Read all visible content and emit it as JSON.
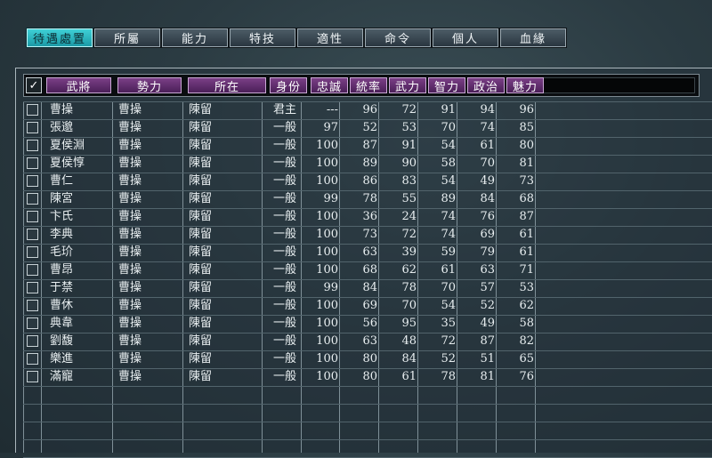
{
  "tabs": [
    {
      "label": "待遇處置",
      "active": true
    },
    {
      "label": "所屬",
      "active": false
    },
    {
      "label": "能力",
      "active": false
    },
    {
      "label": "特技",
      "active": false
    },
    {
      "label": "適性",
      "active": false
    },
    {
      "label": "命令",
      "active": false
    },
    {
      "label": "個人",
      "active": false
    },
    {
      "label": "血緣",
      "active": false
    }
  ],
  "table": {
    "check_all": "✓",
    "columns": [
      "武將",
      "勢力",
      "所在",
      "身份",
      "忠誠",
      "統率",
      "武力",
      "智力",
      "政治",
      "魅力"
    ],
    "rows": [
      [
        "曹操",
        "曹操",
        "陳留",
        "君主",
        "---",
        "96",
        "72",
        "91",
        "94",
        "96"
      ],
      [
        "張邈",
        "曹操",
        "陳留",
        "一般",
        "97",
        "52",
        "53",
        "70",
        "74",
        "85"
      ],
      [
        "夏侯淵",
        "曹操",
        "陳留",
        "一般",
        "100",
        "87",
        "91",
        "54",
        "61",
        "80"
      ],
      [
        "夏侯惇",
        "曹操",
        "陳留",
        "一般",
        "100",
        "89",
        "90",
        "58",
        "70",
        "81"
      ],
      [
        "曹仁",
        "曹操",
        "陳留",
        "一般",
        "100",
        "86",
        "83",
        "54",
        "49",
        "73"
      ],
      [
        "陳宮",
        "曹操",
        "陳留",
        "一般",
        "99",
        "78",
        "55",
        "89",
        "84",
        "68"
      ],
      [
        "卞氏",
        "曹操",
        "陳留",
        "一般",
        "100",
        "36",
        "24",
        "74",
        "76",
        "87"
      ],
      [
        "李典",
        "曹操",
        "陳留",
        "一般",
        "100",
        "73",
        "72",
        "74",
        "69",
        "61"
      ],
      [
        "毛玠",
        "曹操",
        "陳留",
        "一般",
        "100",
        "63",
        "39",
        "59",
        "79",
        "61"
      ],
      [
        "曹昂",
        "曹操",
        "陳留",
        "一般",
        "100",
        "68",
        "62",
        "61",
        "63",
        "71"
      ],
      [
        "于禁",
        "曹操",
        "陳留",
        "一般",
        "99",
        "84",
        "78",
        "70",
        "57",
        "53"
      ],
      [
        "曹休",
        "曹操",
        "陳留",
        "一般",
        "100",
        "69",
        "70",
        "54",
        "52",
        "62"
      ],
      [
        "典韋",
        "曹操",
        "陳留",
        "一般",
        "100",
        "56",
        "95",
        "35",
        "49",
        "58"
      ],
      [
        "劉馥",
        "曹操",
        "陳留",
        "一般",
        "100",
        "63",
        "48",
        "72",
        "87",
        "82"
      ],
      [
        "樂進",
        "曹操",
        "陳留",
        "一般",
        "100",
        "80",
        "84",
        "52",
        "51",
        "65"
      ],
      [
        "滿寵",
        "曹操",
        "陳留",
        "一般",
        "100",
        "80",
        "61",
        "78",
        "81",
        "76"
      ]
    ]
  }
}
